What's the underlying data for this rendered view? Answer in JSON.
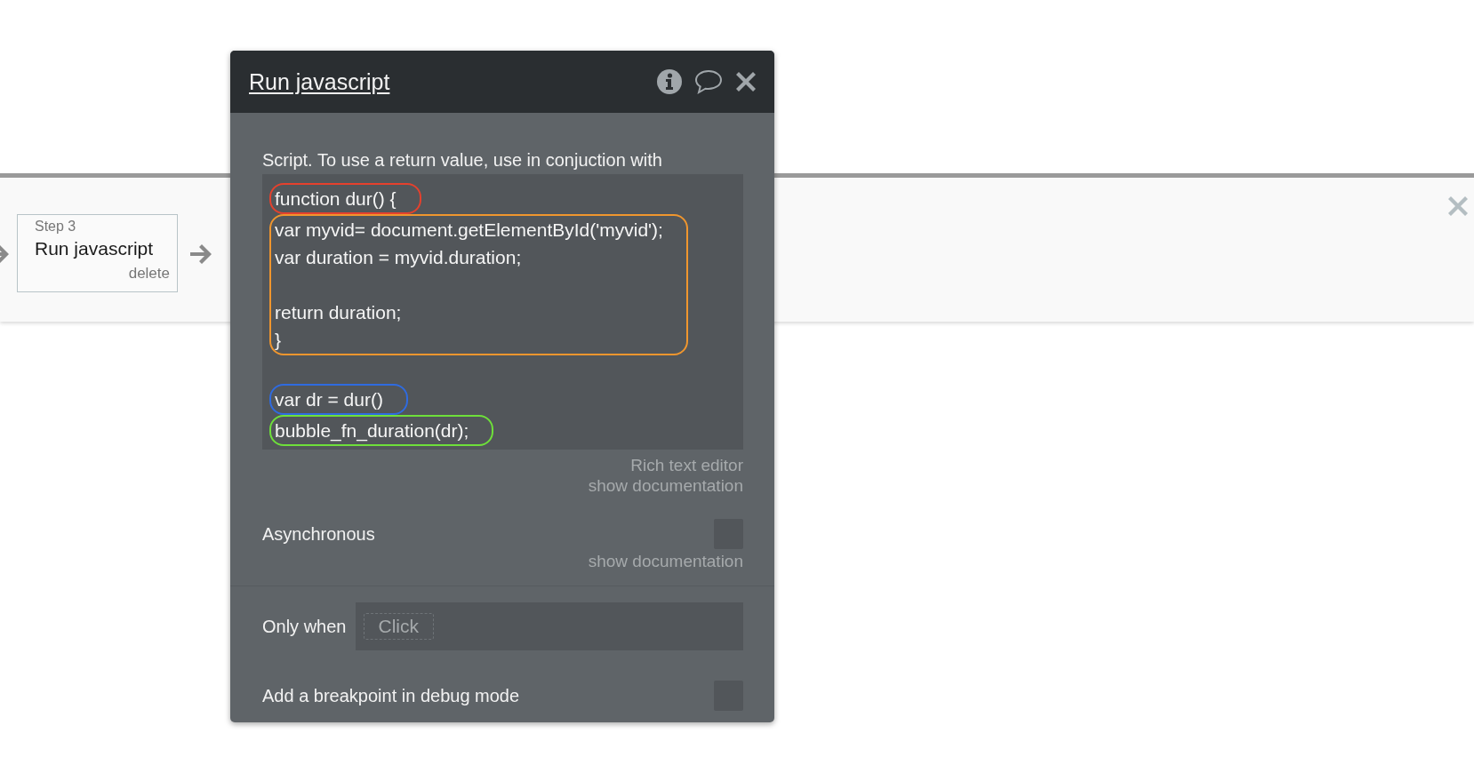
{
  "workflow": {
    "step": {
      "number": "Step 3",
      "name": "Run javascript",
      "action": "delete"
    }
  },
  "panel": {
    "title": "Run javascript",
    "script_label": "Script. To use a return value, use in conjuction with",
    "code_groups": [
      {
        "color": "#e5412d",
        "lines": [
          {
            "kind": "code",
            "text": "function dur() {"
          }
        ]
      },
      {
        "color": "#f0962e",
        "lines": [
          {
            "kind": "code",
            "text": "var myvid= document.getElementById('myvid');"
          },
          {
            "kind": "code",
            "text": "var duration = myvid.duration;"
          },
          {
            "kind": "blank"
          },
          {
            "kind": "code",
            "text": "return duration;"
          },
          {
            "kind": "code",
            "text": "}"
          }
        ]
      },
      {
        "color": "#2f6be0",
        "lines": [
          {
            "kind": "code",
            "text": "var dr = dur()"
          }
        ]
      },
      {
        "color": "#6ee03a",
        "lines": [
          {
            "kind": "code",
            "text": "bubble_fn_duration(dr);"
          }
        ]
      }
    ],
    "editor_links": [
      "Rich text editor",
      "show documentation"
    ],
    "asynchronous": {
      "label": "Asynchronous",
      "checked": false,
      "doc_link": "show documentation"
    },
    "only_when": {
      "label": "Only when",
      "placeholder": "Click"
    },
    "breakpoint": {
      "label": "Add a breakpoint in debug mode",
      "checked": false
    }
  }
}
